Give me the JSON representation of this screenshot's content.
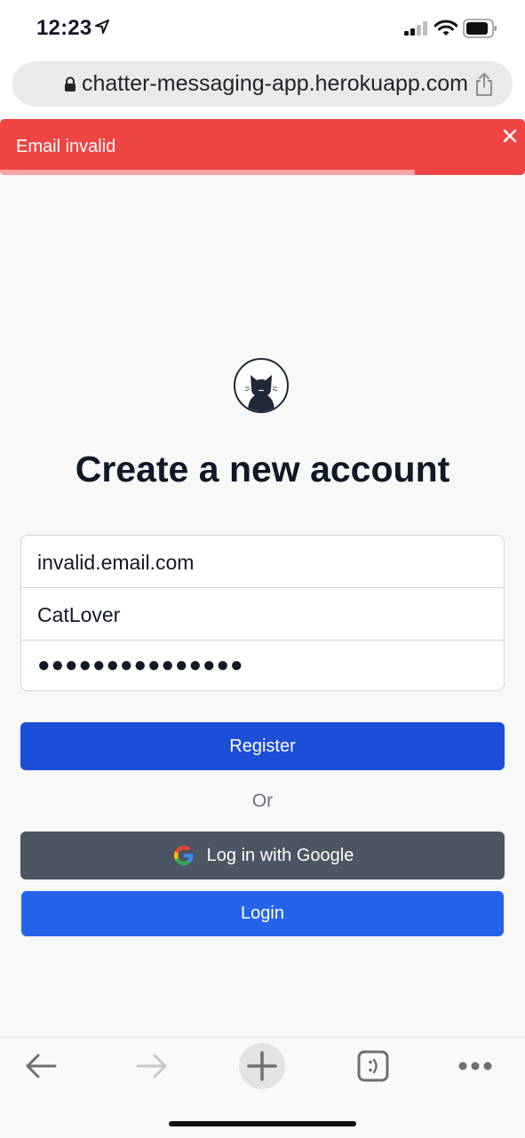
{
  "status_bar": {
    "time": "12:23"
  },
  "browser": {
    "url": "chatter-messaging-app.herokuapp.com"
  },
  "toast": {
    "message": "Email invalid",
    "progress_remaining": 0.79
  },
  "page": {
    "title": "Create a new account"
  },
  "form": {
    "email_value": "invalid.email.com",
    "username_value": "CatLover",
    "password_masked": "●●●●●●●●●●●●●●●"
  },
  "buttons": {
    "register": "Register",
    "or": "Or",
    "google": "Log in with Google",
    "login": "Login"
  },
  "colors": {
    "toast": "#ef4444",
    "register": "#1d4ed8",
    "google": "#4b5563",
    "login": "#2563eb"
  },
  "icons": {
    "status": [
      "location-arrow-icon",
      "signal-icon",
      "wifi-icon",
      "battery-icon"
    ],
    "browser": [
      "lock-icon",
      "share-icon"
    ],
    "toolbar": [
      "back-icon",
      "forward-icon",
      "new-tab-icon",
      "tabs-icon",
      "more-icon"
    ]
  }
}
